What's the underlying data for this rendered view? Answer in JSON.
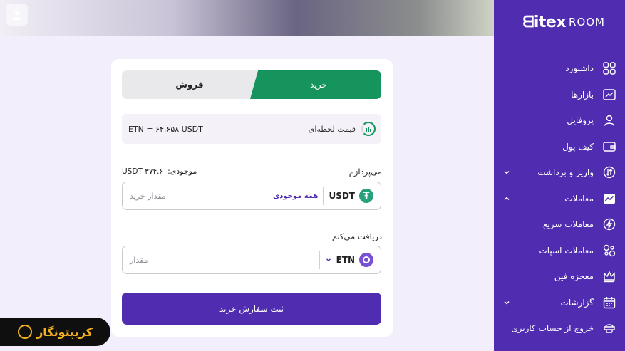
{
  "brand": {
    "logo_mark": "ᗺitex",
    "logo_room": "ROOM"
  },
  "sidebar": {
    "items": [
      {
        "label": "داشبورد",
        "icon": "dashboard-grid-icon"
      },
      {
        "label": "بازارها",
        "icon": "chart-line-icon"
      },
      {
        "label": "پروفایل",
        "icon": "user-icon"
      },
      {
        "label": "کیف پول",
        "icon": "wallet-icon"
      },
      {
        "label": "واریز و برداشت",
        "icon": "deposit-withdraw-icon",
        "chevron": "down"
      },
      {
        "label": "معاملات",
        "icon": "trade-chart-icon",
        "chevron": "up"
      },
      {
        "label": "معاملات سریع",
        "icon": "lightning-icon"
      },
      {
        "label": "معاملات اسپات",
        "icon": "spot-exchange-icon"
      },
      {
        "label": "معجزه فین",
        "icon": "crown-icon"
      },
      {
        "label": "گزارشات",
        "icon": "calendar-report-icon",
        "chevron": "down"
      },
      {
        "label": "خروج از حساب کاربری",
        "icon": "logout-icon"
      }
    ]
  },
  "trade": {
    "tab_buy": "خرید",
    "tab_sell": "فروش",
    "price_label": "قیمت لحظه‌ای",
    "price_value": "ETN = ۶۴,۶۵۸ USDT",
    "pay_label": "می‌پردازم",
    "balance_label": "موجودی:",
    "balance_value": "USDT ۳۷۴.۶",
    "pay_coin": "USDT",
    "all_balance": "همه موجودی",
    "pay_placeholder": "مقدار خرید",
    "recv_label": "دریافت می‌کنم",
    "recv_coin": "ETN",
    "recv_placeholder": "مقدار",
    "submit": "ثبت سفارش خرید"
  },
  "badge": {
    "text": "کریپتونگار"
  },
  "colors": {
    "primary": "#4f2cb0",
    "buy": "#16945e",
    "usdt": "#26a17b",
    "badge_text": "#f2b01e"
  }
}
